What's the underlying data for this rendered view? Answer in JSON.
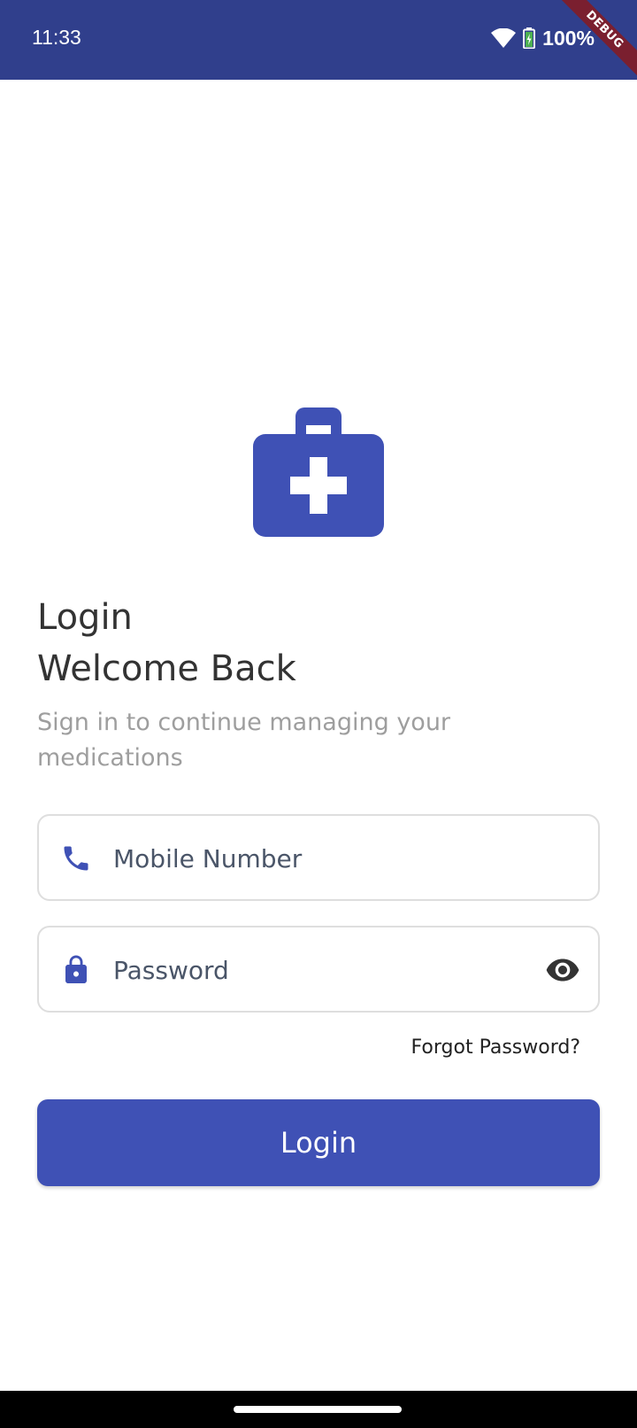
{
  "status_bar": {
    "time": "11:33",
    "battery": "100%",
    "debug_label": "DEBUG",
    "background_color": "#303f8c"
  },
  "logo": {
    "icon": "medical-kit-icon",
    "color": "#3f51b5"
  },
  "header": {
    "title": "Login",
    "subtitle_heading": "Welcome Back",
    "description": "Sign in to continue managing your medications"
  },
  "form": {
    "phone": {
      "placeholder": "Mobile Number",
      "value": "",
      "icon": "phone-icon"
    },
    "password": {
      "placeholder": "Password",
      "value": "",
      "icon": "lock-icon",
      "toggle_icon": "eye-icon"
    },
    "forgot_password": "Forgot Password?",
    "submit_label": "Login"
  },
  "colors": {
    "accent": "#3f51b5",
    "text_primary": "#333333",
    "text_secondary": "#9e9e9e",
    "border": "#dedede"
  }
}
